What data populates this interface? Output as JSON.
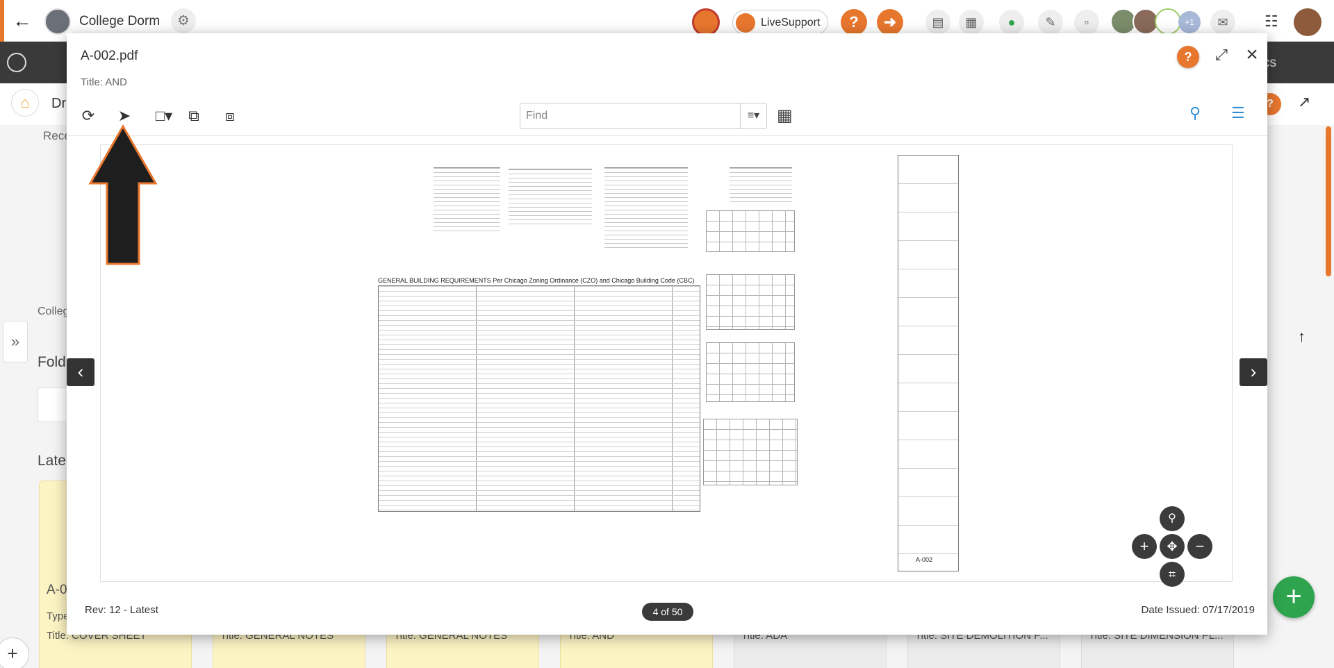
{
  "topbar": {
    "back_icon": "arrow-left-icon",
    "project_name": "College Dorm",
    "livesupport_label": "LiveSupport",
    "help_glyph": "?",
    "extra_users_count": "+1"
  },
  "darkbar": {
    "right_text": "cs"
  },
  "subbar": {
    "title": "Dr",
    "help_glyph": "?"
  },
  "background": {
    "recent_label": "Rece",
    "breadcrumb_label": "Colleg",
    "folders_heading": "Fold",
    "latest_heading": "Late",
    "card_a_label": "A-0",
    "card_type_label": "Type",
    "cards": [
      "Title: COVER SHEET",
      "Title: GENERAL NOTES",
      "Title: GENERAL NOTES",
      "Title: AND",
      "Title: ADA",
      "Title: SITE DEMOLITION P...",
      "Title: SITE DIMENSION PL..."
    ]
  },
  "viewer": {
    "file_name": "A-002.pdf",
    "title_line": "Title: AND",
    "find_placeholder": "Find",
    "revision": "Rev: 12 - Latest",
    "page_indicator": "4 of 50",
    "date_issued": "Date Issued: 07/17/2019",
    "sheet_heading": "GENERAL BUILDING REQUIREMENTS Per Chicago Zoning Ordinance (CZO) and Chicago Building Code (CBC)",
    "sheet_number": "A-002"
  },
  "colors": {
    "accent_orange": "#e8772e",
    "toolbar_blue": "#2f8fd6",
    "fab_green": "#2ea44f",
    "dark": "#3a3a3a"
  },
  "icons": {
    "refresh": "refresh-icon",
    "markup": "markup-icon",
    "add_file": "add-file-icon",
    "compare": "compare-icon",
    "overlay": "overlay-icon",
    "grid": "grid-view-icon",
    "search": "search-icon",
    "layers": "layers-icon",
    "expand": "expand-icon",
    "close": "close-icon"
  }
}
